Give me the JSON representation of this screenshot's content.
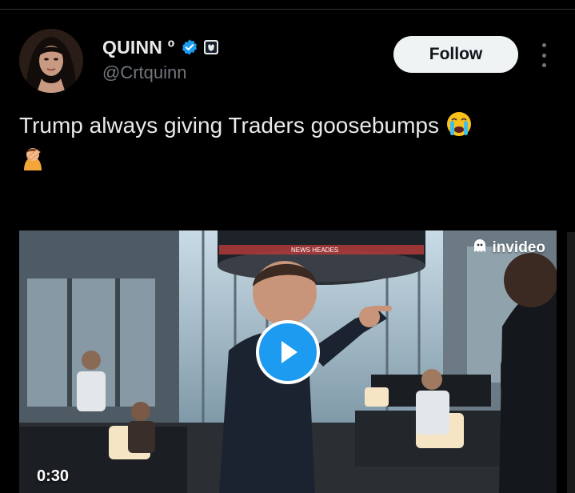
{
  "author": {
    "display_name": "QUINN º",
    "handle": "@Crtquinn",
    "verified_icon": "verified-check-icon",
    "badge_icon": "affiliate-badge-icon"
  },
  "follow_button": {
    "label": "Follow"
  },
  "more_menu": {
    "icon": "more-vertical-icon"
  },
  "tweet": {
    "text": "Trump always giving Traders goosebumps",
    "emojis": [
      "loudly-crying-face-emoji",
      "person-facepalming-emoji"
    ]
  },
  "video": {
    "watermark": "invideo",
    "duration": "0:30",
    "ticker_text": "NEWS HEADES",
    "play_icon": "play-icon"
  },
  "colors": {
    "accent": "#1d9bf0",
    "background": "#000000",
    "text": "#e7e9ea",
    "muted": "#71767b"
  }
}
